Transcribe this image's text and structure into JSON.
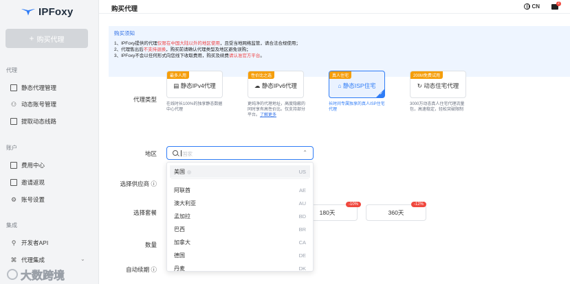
{
  "app": {
    "logo_text": "IPFoxy"
  },
  "header": {
    "title": "购买代理",
    "lang": "CN",
    "msg_count": "2"
  },
  "sidebar": {
    "buy_button": "购买代理",
    "sections": [
      {
        "title": "代理",
        "items": [
          "静态代理管理",
          "动态账号管理",
          "提取动态线路"
        ]
      },
      {
        "title": "账户",
        "items": [
          "费用中心",
          "邀请返现",
          "账号设置"
        ]
      },
      {
        "title": "集成",
        "items": [
          "开发者API",
          "代理集成"
        ]
      }
    ]
  },
  "notice": {
    "title": "购买须知",
    "lines": [
      {
        "prefix": "1、IPFoxy提供的代理",
        "red": "仅限在中国大陆以外的地区使用",
        "suffix": "，且受当地网络监管，请合法合规使用；"
      },
      {
        "prefix": "2、代理售出后",
        "red": "不支持退换",
        "suffix": "，购买前请确认代理类型及地区避免误购；"
      },
      {
        "prefix": "3、IPFoxy不会以任何形式向您线下收取费用，购买及续费",
        "red": "请认准官方平台",
        "suffix": "。"
      }
    ]
  },
  "form": {
    "proxy_type_label": "代理类型",
    "region_label": "地区",
    "provider_label": "选择供应商",
    "package_label": "选择套餐",
    "quantity_label": "数量",
    "auto_renew_label": "自动续期"
  },
  "proxy_types": [
    {
      "tag": "最多人用",
      "tag_color": "#f59e0b",
      "label": "静态IPv4代理",
      "desc": "在线时长100%的独享静态数据中心代理"
    },
    {
      "tag": "性价比之选",
      "tag_color": "#f59e0b",
      "label": "静态IPv6代理",
      "desc": "更纯净的代理地址，高度隐蔽的同时享有高性价比。仅支持部分平台。",
      "link": "了解更多"
    },
    {
      "tag": "真人住宅",
      "tag_color": "#f59e0b",
      "label": "静态ISP住宅",
      "desc": "长时间专属独享的真人ISP住宅代理",
      "selected": true
    },
    {
      "tag": "200M免费试用",
      "tag_color": "#f59e0b",
      "label": "动态住宅代理",
      "desc": "3000万动态真人住宅代理流量包，高速稳定，轻松突破限制"
    }
  ],
  "region": {
    "placeholder": "国家",
    "options": [
      {
        "name": "美国",
        "code": "US",
        "active": true
      },
      {
        "name": "阿联酋",
        "code": "AE"
      },
      {
        "name": "澳大利亚",
        "code": "AU"
      },
      {
        "name": "孟加拉",
        "code": "BD"
      },
      {
        "name": "巴西",
        "code": "BR"
      },
      {
        "name": "加拿大",
        "code": "CA"
      },
      {
        "name": "德国",
        "code": "DE"
      },
      {
        "name": "丹麦",
        "code": "DK"
      }
    ]
  },
  "packages": [
    {
      "label": "180天",
      "discount": "-10%"
    },
    {
      "label": "360天",
      "discount": "-12%"
    }
  ],
  "watermark": "大数跨境"
}
